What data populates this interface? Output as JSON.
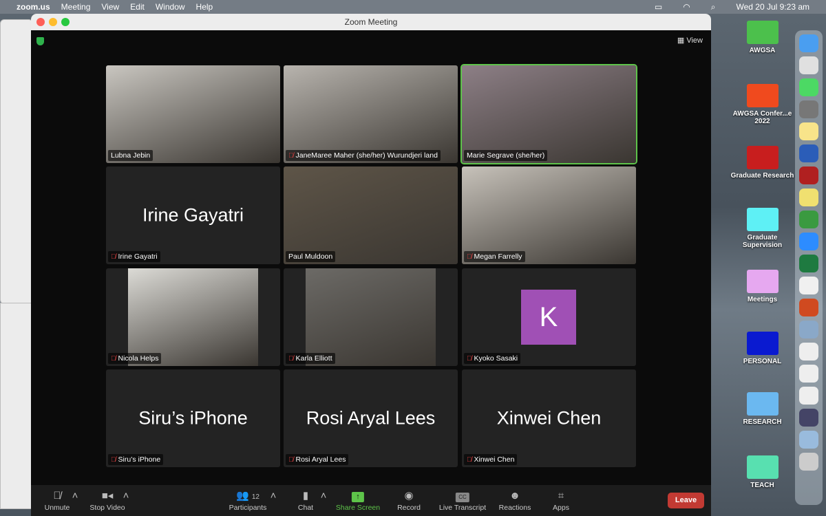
{
  "menubar": {
    "app": "zoom.us",
    "items": [
      "Meeting",
      "View",
      "Edit",
      "Window",
      "Help"
    ],
    "clock": "Wed 20 Jul  9:23 am"
  },
  "window": {
    "title": "Zoom Meeting",
    "view_label": "View"
  },
  "tiles": [
    {
      "name": "Lubna Jebin",
      "type": "video",
      "color": "#c9c6c0",
      "muted": false
    },
    {
      "name": "JaneMaree Maher (she/her) Wurundjeri land",
      "type": "video",
      "color": "#b8b4ae",
      "muted": true
    },
    {
      "name": "Marie Segrave (she/her)",
      "type": "video",
      "color": "#8d7f86",
      "muted": false,
      "active": true
    },
    {
      "name": "Irine Gayatri",
      "type": "name",
      "muted": true
    },
    {
      "name": "Paul Muldoon",
      "type": "video",
      "color": "#5e5548",
      "muted": false
    },
    {
      "name": "Megan Farrelly",
      "type": "video",
      "color": "#c7c2ba",
      "muted": true
    },
    {
      "name": "Nicola Helps",
      "type": "video",
      "color": "#dcdbd6",
      "muted": true
    },
    {
      "name": "Karla Elliott",
      "type": "video",
      "color": "#6c6a66",
      "muted": true
    },
    {
      "name": "Kyoko Sasaki",
      "type": "avatar",
      "initial": "K",
      "muted": true
    },
    {
      "name": "Siru’s iPhone",
      "type": "name",
      "muted": true
    },
    {
      "name": "Rosi Aryal Lees",
      "type": "name",
      "muted": true
    },
    {
      "name": "Xinwei Chen",
      "type": "name",
      "muted": true
    }
  ],
  "toolbar": {
    "unmute": "Unmute",
    "stop_video": "Stop Video",
    "participants": "Participants",
    "participants_count": "12",
    "chat": "Chat",
    "share_screen": "Share Screen",
    "record": "Record",
    "live_transcript": "Live Transcript",
    "reactions": "Reactions",
    "apps": "Apps",
    "leave": "Leave"
  },
  "desktop": {
    "folders": [
      {
        "label": "AWGSA",
        "color": "#4cc04c"
      },
      {
        "label": "AWGSA Confer...e 2022",
        "color": "#f04a1e"
      },
      {
        "label": "Graduate Research",
        "color": "#c81e1e"
      },
      {
        "label": "Graduate Supervision",
        "color": "#5ef0f5"
      },
      {
        "label": "Meetings",
        "color": "#e6a8f0"
      },
      {
        "label": "PERSONAL",
        "color": "#0a1ad0"
      },
      {
        "label": "RESEARCH",
        "color": "#6bb8f0"
      },
      {
        "label": "TEACH",
        "color": "#58e0b0"
      }
    ]
  },
  "dock": {
    "apps": [
      "finder",
      "launchpad",
      "messages",
      "system-preferences",
      "notes",
      "word",
      "acrobat",
      "stickies",
      "teams-video",
      "zoom",
      "excel",
      "chrome",
      "powerpoint",
      "preview",
      "document-1",
      "document-2",
      "document-3",
      "chrome-window",
      "preview-window",
      "trash"
    ]
  }
}
